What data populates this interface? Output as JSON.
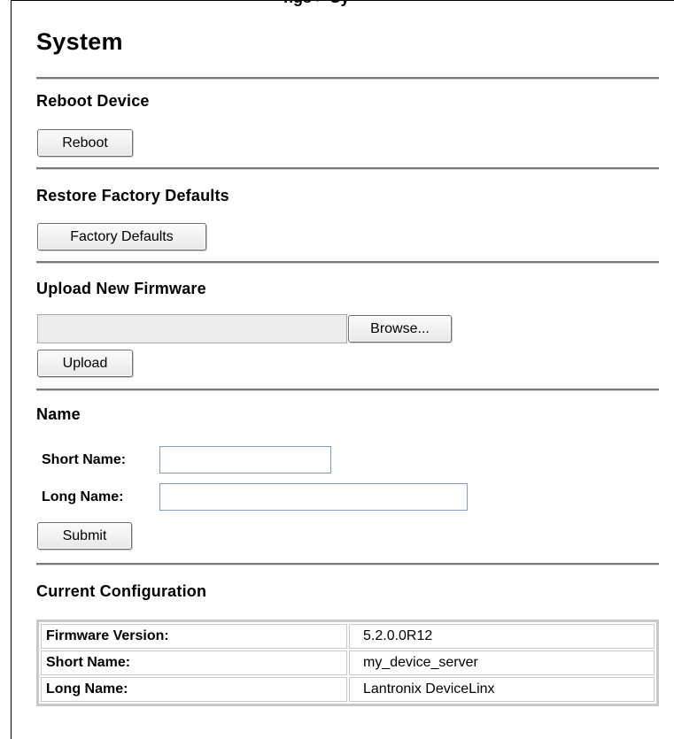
{
  "top_title_fragment": "ngs > Sy",
  "page": {
    "heading": "System"
  },
  "reboot": {
    "title": "Reboot Device",
    "button": "Reboot"
  },
  "factory": {
    "title": "Restore Factory Defaults",
    "button": "Factory Defaults"
  },
  "firmware": {
    "title": "Upload New Firmware",
    "file_value": "",
    "browse_button": "Browse...",
    "upload_button": "Upload"
  },
  "name": {
    "title": "Name",
    "short_label": "Short Name:",
    "short_value": "",
    "long_label": "Long Name:",
    "long_value": "",
    "submit_button": "Submit"
  },
  "config": {
    "title": "Current Configuration",
    "rows": [
      {
        "label": "Firmware Version:",
        "value": "5.2.0.0R12"
      },
      {
        "label": "Short Name:",
        "value": "my_device_server"
      },
      {
        "label": "Long Name:",
        "value": "Lantronix DeviceLinx"
      }
    ]
  }
}
